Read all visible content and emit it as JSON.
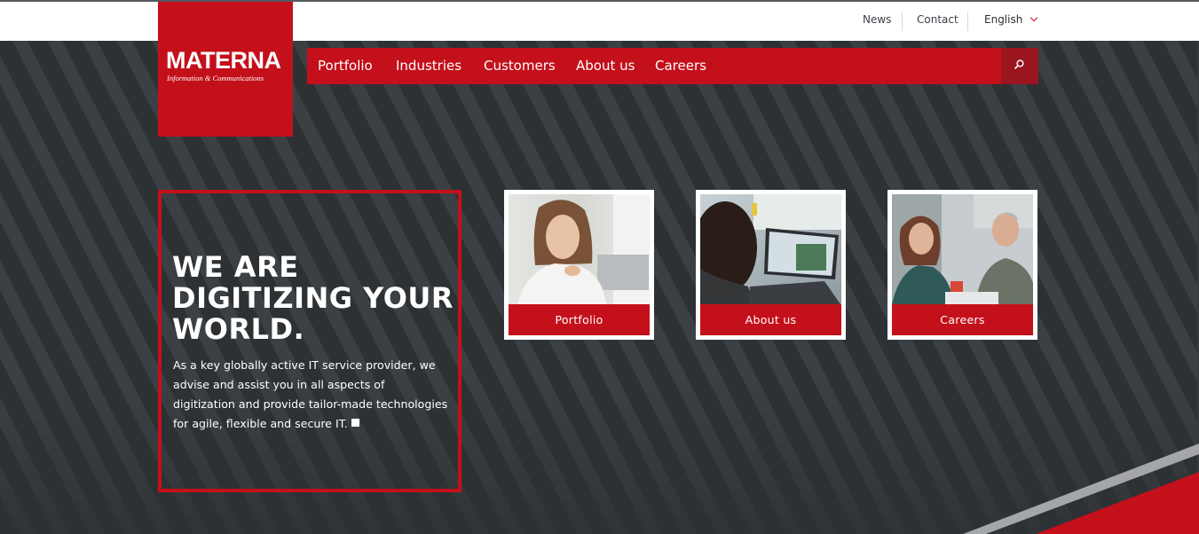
{
  "utility_nav": {
    "news": "News",
    "contact": "Contact",
    "language": "English"
  },
  "logo": {
    "wordmark": "MATERNA",
    "tagline": "Information & Communications"
  },
  "main_nav": {
    "items": [
      {
        "label": "Portfolio"
      },
      {
        "label": "Industries"
      },
      {
        "label": "Customers"
      },
      {
        "label": "About us"
      },
      {
        "label": "Careers"
      }
    ],
    "search_icon": "search-icon"
  },
  "hero": {
    "headline_line1": "WE ARE",
    "headline_line2": "DIGITIZING YOUR",
    "headline_line3": "WORLD.",
    "lead": "As a key globally active IT service provider, we advise and assist you in all aspects of digitization and provide tailor-made technologies for agile, flexible and secure IT."
  },
  "cards": [
    {
      "label": "Portfolio",
      "image": "woman-at-laptop-photo"
    },
    {
      "label": "About us",
      "image": "person-typing-on-laptop-photo"
    },
    {
      "label": "Careers",
      "image": "colleagues-meeting-photo"
    }
  ],
  "colors": {
    "brand_red": "#c4101b",
    "dark_red": "#9b1520",
    "stripe_dark": "#2d3134",
    "stripe_light": "#3b4044",
    "accent_gray": "#a4a6a9"
  }
}
